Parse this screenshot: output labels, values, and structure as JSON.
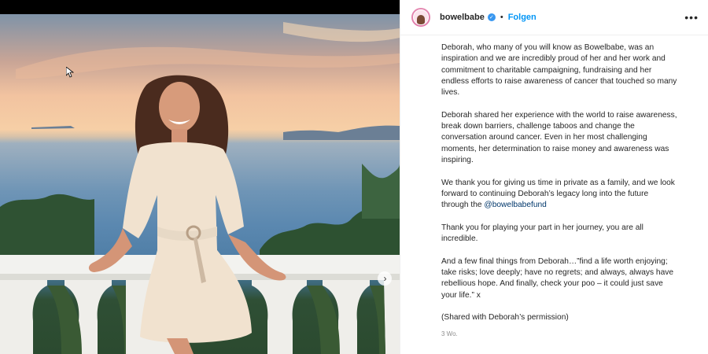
{
  "post": {
    "username": "bowelbabe",
    "follow_label": "Folgen",
    "separator": "•",
    "more_label": "•••",
    "timestamp": "3 Wo."
  },
  "caption": {
    "p1": "Deborah, who many of you will know as Bowelbabe, was an inspiration and we are incredibly proud of her and her work and commitment to charitable campaigning, fundraising and her endless efforts to raise awareness of cancer that touched so many lives.",
    "p2": "Deborah shared her experience with the world to raise awareness, break down barriers, challenge taboos and change the conversation around cancer. Even in her most challenging moments, her determination to raise money and awareness was inspiring.",
    "p3_text": "We thank you for giving us time in private as a family, and we look forward to continuing Deborah’s legacy long into the future through the ",
    "p3_mention": "@bowelbabefund",
    "p4": "Thank you for playing your part in her journey, you are all incredible.",
    "p5": "And a few final things from Deborah…”find a life worth enjoying; take risks; love deeply; have no regrets; and always, always have rebellious hope. And finally, check your poo – it could just save your life.” x",
    "p6": "(Shared with Deborah’s permission)"
  },
  "icons": {
    "next": "chevron-right-icon",
    "verified": "verified-badge-icon",
    "more": "more-options-icon"
  },
  "colors": {
    "follow": "#0095f6",
    "mention": "#00376b",
    "verified": "#3897f0",
    "text": "#262626",
    "muted": "#8e8e8e"
  }
}
